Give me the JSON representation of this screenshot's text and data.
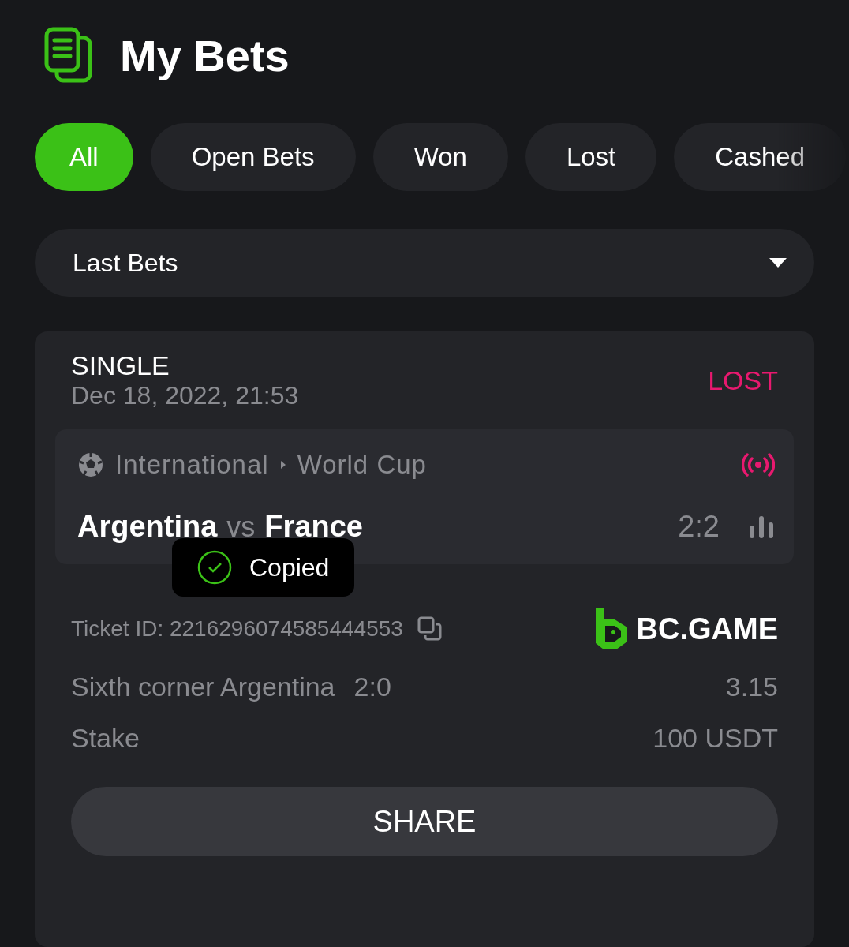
{
  "header": {
    "title": "My Bets"
  },
  "tabs": [
    {
      "label": "All",
      "selected": true
    },
    {
      "label": "Open Bets",
      "selected": false
    },
    {
      "label": "Won",
      "selected": false
    },
    {
      "label": "Lost",
      "selected": false
    },
    {
      "label": "Cashed",
      "selected": false
    }
  ],
  "filter": {
    "value": "Last Bets"
  },
  "bet": {
    "type": "SINGLE",
    "date": "Dec 18, 2022, 21:53",
    "status": "LOST",
    "league": "International",
    "tournament": "World Cup",
    "live": true,
    "home": "Argentina",
    "vs": "vs",
    "away": "France",
    "score": "2:2",
    "ticket": "Ticket ID: 2216296074585444553",
    "brand": "BC.GAME",
    "selection": "Sixth corner Argentina",
    "selection_score": "2:0",
    "odds": "3.15",
    "stake_label": "Stake",
    "stake": "100 USDT",
    "share": "SHARE"
  },
  "toast": {
    "text": "Copied"
  }
}
